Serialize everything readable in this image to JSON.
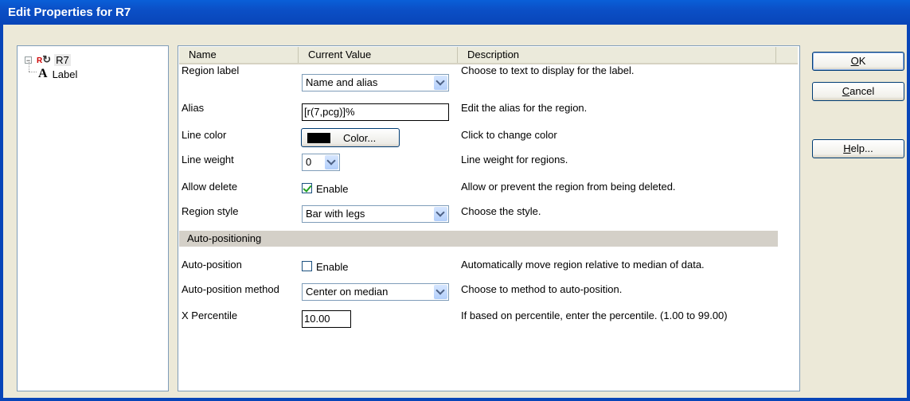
{
  "window": {
    "title": "Edit Properties for R7"
  },
  "tree": {
    "root_expander": "⊟",
    "root_icon": "R",
    "root_label": "R7",
    "child_label": "Label"
  },
  "grid": {
    "headers": [
      "Name",
      "Current Value",
      "Description"
    ],
    "rows": [
      {
        "name": "Region label",
        "value": "Name and alias",
        "desc": "Choose to text to display for the label."
      },
      {
        "name": "Alias",
        "value": "[r(7,pcg)]%",
        "desc": "Edit the alias for the region."
      },
      {
        "name": "Line color",
        "value": "Color...",
        "desc": "Click to change color"
      },
      {
        "name": "Line weight",
        "value": "0",
        "desc": "Line weight for regions."
      },
      {
        "name": "Allow delete",
        "value": "Enable",
        "desc": "Allow or prevent the region from being deleted."
      },
      {
        "name": "Region style",
        "value": "Bar with legs",
        "desc": "Choose the style."
      }
    ],
    "section": "Auto-positioning",
    "rows2": [
      {
        "name": "Auto-position",
        "value": "Enable",
        "desc": "Automatically move region relative to median of data."
      },
      {
        "name": "Auto-position method",
        "value": "Center on median",
        "desc": "Choose to method to auto-position."
      },
      {
        "name": "X Percentile",
        "value": "10.00",
        "desc": "If based on percentile, enter the percentile. (1.00 to 99.00)"
      }
    ]
  },
  "buttons": {
    "ok_u": "O",
    "ok_rest": "K",
    "cancel_u": "C",
    "cancel_rest": "ancel",
    "help_u": "H",
    "help_rest": "elp..."
  },
  "colors": {
    "line_color": "#000000",
    "title_bar": "#0845b8"
  }
}
